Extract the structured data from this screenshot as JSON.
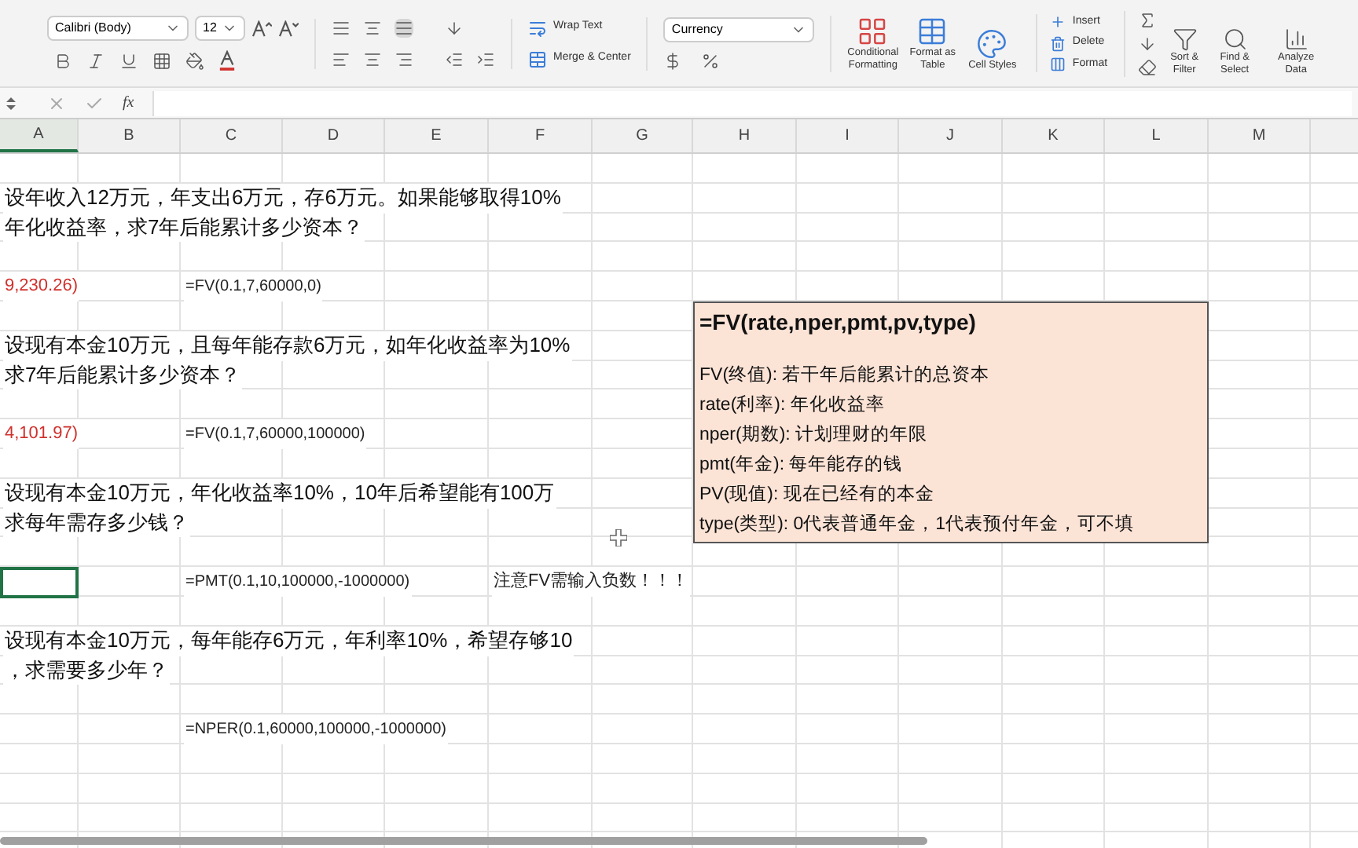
{
  "ribbon": {
    "font": "Calibri (Body)",
    "font_size": "12",
    "wrap_text": "Wrap Text",
    "merge": "Merge & Center",
    "number_format": "Currency",
    "style_buttons": [
      {
        "label": "Conditional Formatting",
        "kind": "conditional"
      },
      {
        "label": "Format as Table",
        "kind": "table"
      },
      {
        "label": "Cell Styles",
        "kind": "styles"
      }
    ],
    "cell_buttons": [
      {
        "label": "Insert",
        "kind": "insert"
      },
      {
        "label": "Delete",
        "kind": "delete"
      },
      {
        "label": "Format",
        "kind": "format"
      }
    ],
    "edit_buttons": [
      {
        "label": "Sort & Filter",
        "kind": "sort"
      },
      {
        "label": "Find & Select",
        "kind": "find"
      }
    ],
    "analyze": "Analyze Data"
  },
  "formula_bar": {
    "fx": "fx"
  },
  "columns": [
    "A",
    "B",
    "C",
    "D",
    "E",
    "F",
    "G",
    "H",
    "I",
    "J",
    "K",
    "L",
    "M"
  ],
  "rows": [
    {},
    {
      "A": {
        "text": "设年收入12万元，年支出6万元，存6万元。如果能够取得10%",
        "kind": "question",
        "selected": false
      }
    },
    {
      "A": {
        "text": "年化收益率，求7年后能累计多少资本？",
        "kind": "question",
        "selected": false
      }
    },
    {},
    {
      "A": {
        "text": "9,230.26)",
        "kind": "negative",
        "selected": false
      },
      "C": {
        "text": "=FV(0.1,7,60000,0)",
        "kind": "formula",
        "selected": false
      }
    },
    {},
    {
      "A": {
        "text": "设现有本金10万元，且每年能存款6万元，如年化收益率为10%",
        "kind": "question",
        "selected": false
      }
    },
    {
      "A": {
        "text": "求7年后能累计多少资本？",
        "kind": "question",
        "selected": false
      }
    },
    {},
    {
      "A": {
        "text": "4,101.97)",
        "kind": "negative",
        "selected": false
      },
      "C": {
        "text": "=FV(0.1,7,60000,100000)",
        "kind": "formula",
        "selected": false
      }
    },
    {},
    {
      "A": {
        "text": "设现有本金10万元，年化收益率10%，10年后希望能有100万",
        "kind": "question",
        "selected": false
      }
    },
    {
      "A": {
        "text": "求每年需存多少钱？",
        "kind": "question",
        "selected": false
      }
    },
    {},
    {
      "A": {
        "selected": true
      },
      "C": {
        "text": "=PMT(0.1,10,100000,-1000000)",
        "kind": "formula",
        "selected": false
      },
      "F": {
        "text": "注意FV需输入负数！！！",
        "kind": "note",
        "selected": false
      }
    },
    {},
    {
      "A": {
        "text": "设现有本金10万元，每年能存6万元，年利率10%，希望存够10",
        "kind": "question",
        "selected": false
      }
    },
    {
      "A": {
        "text": "，求需要多少年？",
        "kind": "question",
        "selected": false
      }
    },
    {},
    {
      "C": {
        "text": "=NPER(0.1,60000,100000,-1000000)",
        "kind": "formula",
        "selected": false
      }
    },
    {}
  ],
  "text_box": {
    "title": "=FV(rate,nper,pmt,pv,type)",
    "lines": [
      "FV(终值): 若干年后能累计的总资本",
      "rate(利率): 年化收益率",
      "nper(期数): 计划理财的年限",
      "pmt(年金): 每年能存的钱",
      "PV(现值): 现在已经有的本金",
      "type(类型): 0代表普通年金，1代表预付年金，可不填"
    ]
  }
}
